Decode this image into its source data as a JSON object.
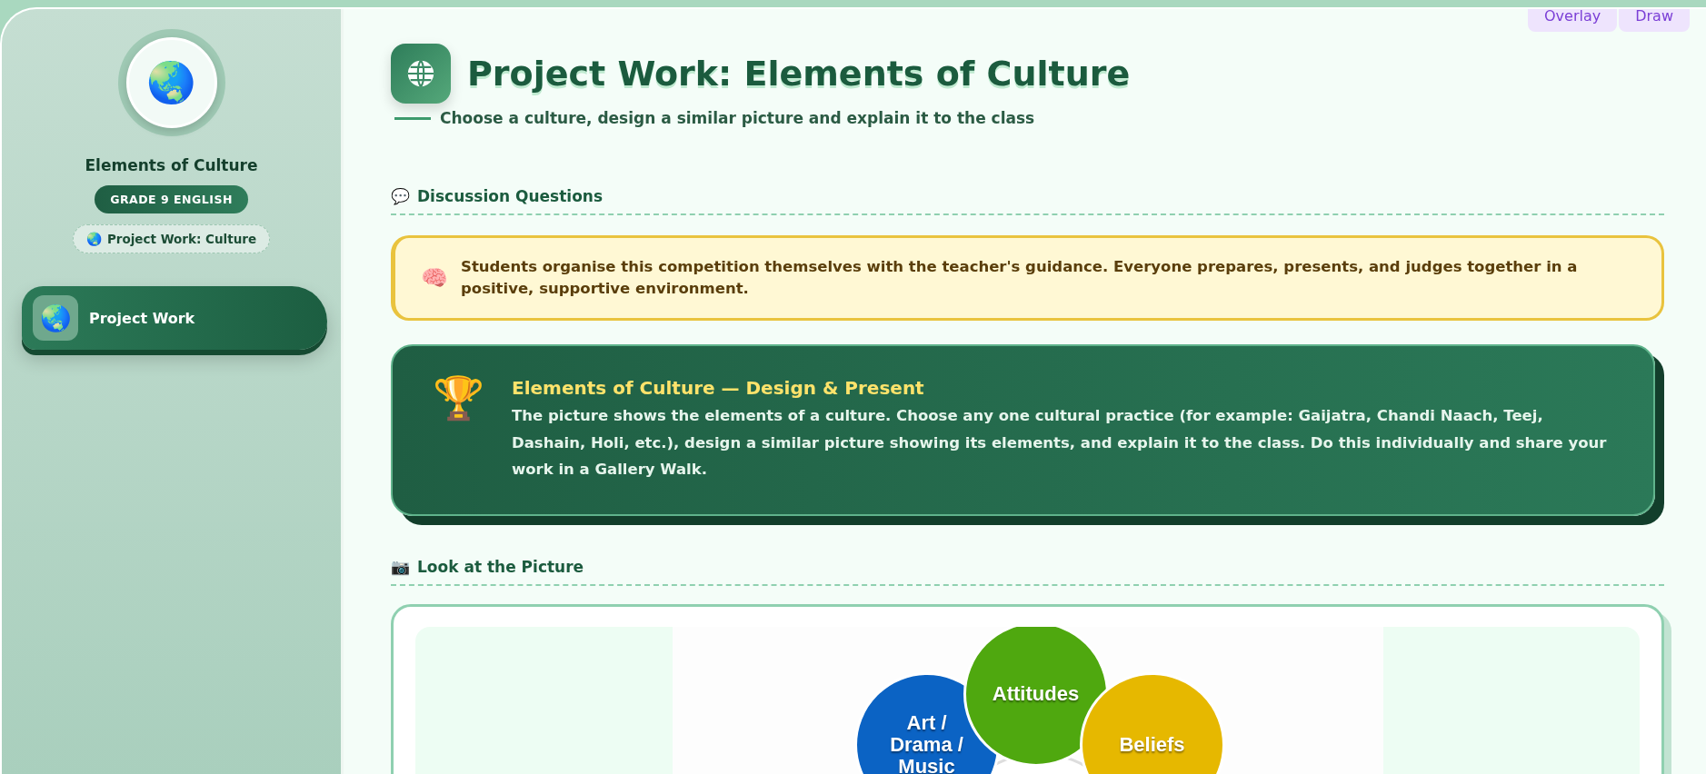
{
  "top_buttons": [
    {
      "label": "Overlay"
    },
    {
      "label": "Draw"
    }
  ],
  "sidebar": {
    "emblem": "🌏",
    "title": "Elements of Culture",
    "badge": "GRADE 9 ENGLISH",
    "chip": {
      "icon": "🌏",
      "label": "Project Work: Culture"
    },
    "nav": [
      {
        "icon": "🌏",
        "label": "Project Work",
        "selected": true
      }
    ]
  },
  "header": {
    "title": "Project Work: Elements of Culture",
    "subtitle": "Choose a culture, design a similar picture and explain it to the class"
  },
  "sections": [
    {
      "icon": "💬",
      "title": "Discussion Questions"
    }
  ],
  "note": {
    "icon": "🧠",
    "text": "Students organise this competition themselves with the teacher's guidance. Everyone prepares, presents, and judges together in a positive, supportive environment."
  },
  "task": {
    "icon": "🏆",
    "title": "Elements of Culture — Design & Present",
    "text": "The picture shows the elements of a culture. Choose any one cultural practice (for example: Gaijatra, Chandi Naach, Teej, Dashain, Holi, etc.), design a similar picture showing its elements, and explain it to the class. Do this individually and share your work in a Gallery Walk."
  },
  "picture_section": {
    "icon": "📷",
    "title": "Look at the Picture"
  },
  "diagram": {
    "circles": [
      {
        "label": "Art / Drama / Music",
        "color": "#0b63c4"
      },
      {
        "label": "Attitudes",
        "color": "#4fa80f"
      },
      {
        "label": "Beliefs",
        "color": "#e6b800"
      }
    ]
  }
}
